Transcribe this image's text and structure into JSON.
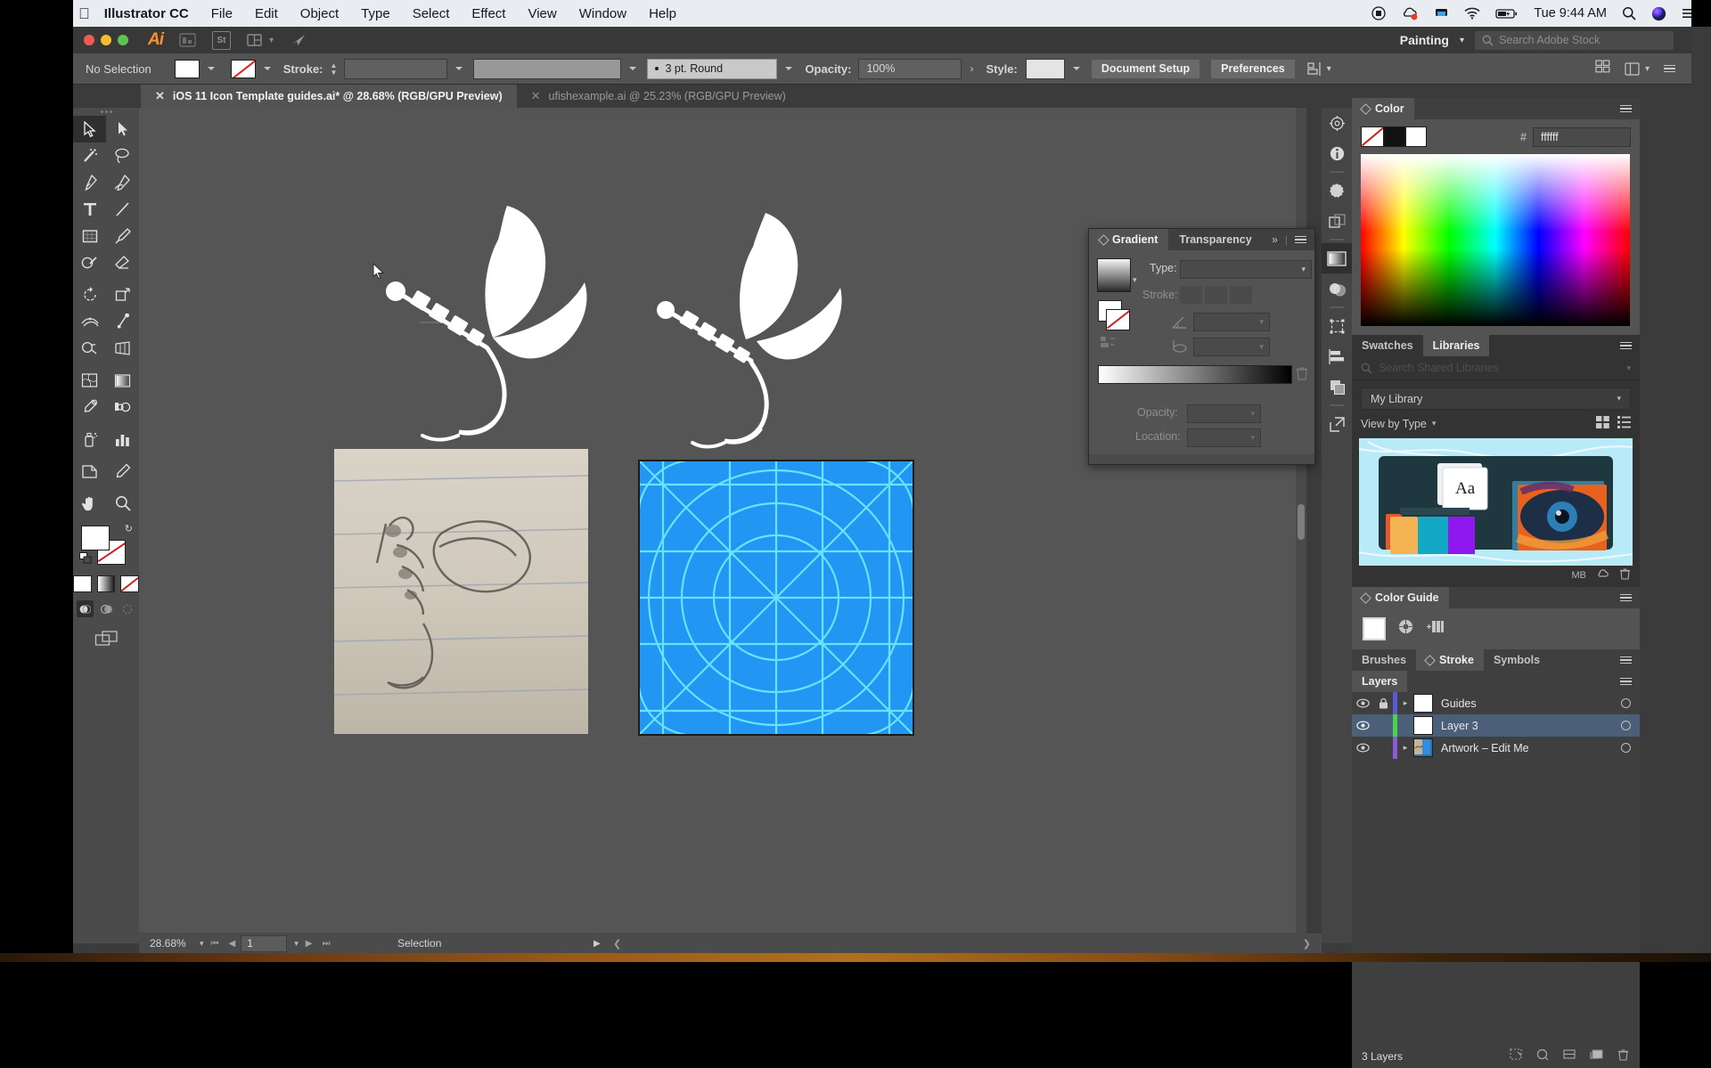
{
  "macbar": {
    "apple": "",
    "app_name": "Illustrator CC",
    "menus": [
      "File",
      "Edit",
      "Object",
      "Type",
      "Select",
      "Effect",
      "View",
      "Window",
      "Help"
    ],
    "status_icons": [
      "screen-record-icon",
      "creative-cloud-icon",
      "dropbox-icon",
      "wifi-icon",
      "battery-charging-icon"
    ],
    "clock": "Tue 9:44 AM",
    "right_icons": [
      "spotlight-search-icon",
      "siri-icon",
      "notification-center-icon"
    ]
  },
  "appbar": {
    "logo": "Ai",
    "bridge_label": "Br",
    "stock_label": "St",
    "arrange_label": "arrange-documents-icon",
    "workspace": "Painting",
    "search_placeholder": "Search Adobe Stock"
  },
  "control_bar": {
    "selection_status": "No Selection",
    "fill_swatch": "white",
    "stroke_swatch": "none",
    "stroke_label": "Stroke:",
    "stroke_weight": "",
    "stroke_profile": "",
    "brush_def": "3 pt. Round",
    "opacity_label": "Opacity:",
    "opacity_value": "100%",
    "style_label": "Style:",
    "document_setup": "Document Setup",
    "preferences": "Preferences",
    "align_icon": "align-icon"
  },
  "tabs": [
    {
      "title": "iOS 11 Icon Template guides.ai* @ 28.68% (RGB/GPU Preview)",
      "active": true
    },
    {
      "title": "ufishexample.ai @ 25.23% (RGB/GPU Preview)",
      "active": false
    }
  ],
  "toolbar": {
    "tools": [
      "selection-tool",
      "direct-selection-tool",
      "magic-wand-tool",
      "lasso-tool",
      "pen-tool",
      "curvature-tool",
      "type-tool",
      "line-segment-tool",
      "rectangle-tool",
      "paintbrush-tool",
      "shaper-tool",
      "eraser-tool",
      "rotate-tool",
      "scale-tool",
      "width-tool",
      "free-transform-tool",
      "shape-builder-tool",
      "perspective-grid-tool",
      "mesh-tool",
      "gradient-tool",
      "eyedropper-tool",
      "blend-tool",
      "symbol-sprayer-tool",
      "column-graph-tool",
      "artboard-tool",
      "slice-tool",
      "hand-tool",
      "zoom-tool"
    ],
    "selected_tool": "selection-tool",
    "fill_color": "#ffffff",
    "stroke_color": "none",
    "color_modes": [
      "color-mode",
      "gradient-mode",
      "none-mode"
    ],
    "draw_modes": [
      "draw-normal",
      "draw-behind",
      "draw-inside"
    ],
    "screen_mode": "change-screen-mode"
  },
  "gradient_panel": {
    "tabs": [
      "Gradient",
      "Transparency"
    ],
    "active_tab": "Gradient",
    "type_label": "Type:",
    "type_value": "",
    "stroke_label": "Stroke:",
    "angle_label": "angle-icon",
    "aspect_label": "aspect-ratio-icon",
    "opacity_label": "Opacity:",
    "opacity_value": "",
    "location_label": "Location:",
    "location_value": "",
    "gradient_from": "#ffffff",
    "gradient_to": "#000000",
    "collapse": "»"
  },
  "dock_strip": {
    "items": [
      "brushes-icon",
      "info-icon",
      "color-guide-icon",
      "artboards-icon",
      "gradient-icon",
      "transparency-icon",
      "transform-icon",
      "align-icon",
      "pathfinder-icon",
      "expand-panels-icon"
    ],
    "active": "gradient-icon"
  },
  "color_panel": {
    "title": "Color",
    "hex_label": "#",
    "hex_value": "ffffff",
    "swatch_none": "none",
    "swatch_fill": "#ffffff"
  },
  "libraries_panel": {
    "tabs": [
      "Swatches",
      "Libraries"
    ],
    "active_tab": "Libraries",
    "search_placeholder": "Search Shared Libraries",
    "library_name": "My Library",
    "view_by": "View by Type",
    "view_grid_icon": "grid-view-icon",
    "view_list_icon": "list-view-icon",
    "size_label": "MB",
    "cc_icon": "creative-cloud-icon",
    "delete_icon": "trash-icon",
    "thumbnail_text": "Aa"
  },
  "color_guide_panel": {
    "title": "Color Guide",
    "base_swatch": "#ffffff",
    "icons": [
      "color-wheel-icon",
      "edit-colors-icon"
    ]
  },
  "stroke_panel": {
    "tabs": [
      "Brushes",
      "Stroke",
      "Symbols"
    ],
    "active_tab": "Stroke"
  },
  "layers_panel": {
    "title": "Layers",
    "rows": [
      {
        "name": "Guides",
        "color": "#5b5bd6",
        "locked": true,
        "visible": true,
        "selected": false,
        "expandable": true,
        "thumb": "blank"
      },
      {
        "name": "Layer 3",
        "color": "#4fd14f",
        "locked": false,
        "visible": true,
        "selected": true,
        "expandable": false,
        "thumb": "blank"
      },
      {
        "name": "Artwork – Edit Me",
        "color": "#8a5bd6",
        "locked": false,
        "visible": true,
        "selected": false,
        "expandable": true,
        "thumb": "art"
      }
    ],
    "footer_count": "3 Layers",
    "footer_icons": [
      "locate-object-icon",
      "make-clipping-mask-icon",
      "create-sublayer-icon",
      "new-layer-icon",
      "delete-layer-icon"
    ]
  },
  "status_bar": {
    "zoom": "28.68%",
    "page": "1",
    "tool_name": "Selection",
    "first_icon": "first-artboard-icon",
    "prev_icon": "prev-artboard-icon",
    "next_icon": "next-artboard-icon",
    "last_icon": "last-artboard-icon"
  },
  "canvas": {
    "artwork": [
      {
        "name": "fishing-fly-vector-left",
        "type": "vector-white"
      },
      {
        "name": "fishing-fly-vector-right",
        "type": "vector-white"
      },
      {
        "name": "pencil-sketch-photo",
        "type": "raster"
      },
      {
        "name": "ios-icon-template-grid",
        "type": "blue-grid",
        "color": "#2196f3",
        "guide_color": "#6ce1ff"
      }
    ],
    "cursor": "arrow-cursor"
  },
  "colors": {
    "accent_blue": "#2196f3",
    "panel_bg": "#3f3f3f",
    "toolbar_bg": "#4b4b4b",
    "canvas_bg": "#555555",
    "selection_blue": "#4b6078"
  }
}
